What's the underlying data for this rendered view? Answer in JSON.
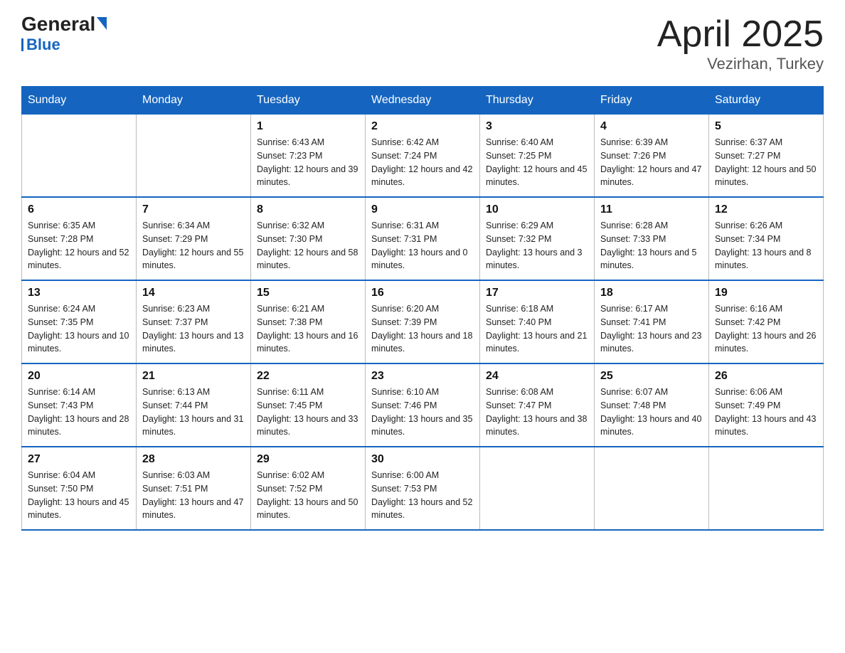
{
  "header": {
    "logo": {
      "general": "General",
      "blue": "Blue"
    },
    "title": "April 2025",
    "subtitle": "Vezirhan, Turkey"
  },
  "weekdays": [
    "Sunday",
    "Monday",
    "Tuesday",
    "Wednesday",
    "Thursday",
    "Friday",
    "Saturday"
  ],
  "weeks": [
    [
      {
        "day": "",
        "sunrise": "",
        "sunset": "",
        "daylight": ""
      },
      {
        "day": "",
        "sunrise": "",
        "sunset": "",
        "daylight": ""
      },
      {
        "day": "1",
        "sunrise": "Sunrise: 6:43 AM",
        "sunset": "Sunset: 7:23 PM",
        "daylight": "Daylight: 12 hours and 39 minutes."
      },
      {
        "day": "2",
        "sunrise": "Sunrise: 6:42 AM",
        "sunset": "Sunset: 7:24 PM",
        "daylight": "Daylight: 12 hours and 42 minutes."
      },
      {
        "day": "3",
        "sunrise": "Sunrise: 6:40 AM",
        "sunset": "Sunset: 7:25 PM",
        "daylight": "Daylight: 12 hours and 45 minutes."
      },
      {
        "day": "4",
        "sunrise": "Sunrise: 6:39 AM",
        "sunset": "Sunset: 7:26 PM",
        "daylight": "Daylight: 12 hours and 47 minutes."
      },
      {
        "day": "5",
        "sunrise": "Sunrise: 6:37 AM",
        "sunset": "Sunset: 7:27 PM",
        "daylight": "Daylight: 12 hours and 50 minutes."
      }
    ],
    [
      {
        "day": "6",
        "sunrise": "Sunrise: 6:35 AM",
        "sunset": "Sunset: 7:28 PM",
        "daylight": "Daylight: 12 hours and 52 minutes."
      },
      {
        "day": "7",
        "sunrise": "Sunrise: 6:34 AM",
        "sunset": "Sunset: 7:29 PM",
        "daylight": "Daylight: 12 hours and 55 minutes."
      },
      {
        "day": "8",
        "sunrise": "Sunrise: 6:32 AM",
        "sunset": "Sunset: 7:30 PM",
        "daylight": "Daylight: 12 hours and 58 minutes."
      },
      {
        "day": "9",
        "sunrise": "Sunrise: 6:31 AM",
        "sunset": "Sunset: 7:31 PM",
        "daylight": "Daylight: 13 hours and 0 minutes."
      },
      {
        "day": "10",
        "sunrise": "Sunrise: 6:29 AM",
        "sunset": "Sunset: 7:32 PM",
        "daylight": "Daylight: 13 hours and 3 minutes."
      },
      {
        "day": "11",
        "sunrise": "Sunrise: 6:28 AM",
        "sunset": "Sunset: 7:33 PM",
        "daylight": "Daylight: 13 hours and 5 minutes."
      },
      {
        "day": "12",
        "sunrise": "Sunrise: 6:26 AM",
        "sunset": "Sunset: 7:34 PM",
        "daylight": "Daylight: 13 hours and 8 minutes."
      }
    ],
    [
      {
        "day": "13",
        "sunrise": "Sunrise: 6:24 AM",
        "sunset": "Sunset: 7:35 PM",
        "daylight": "Daylight: 13 hours and 10 minutes."
      },
      {
        "day": "14",
        "sunrise": "Sunrise: 6:23 AM",
        "sunset": "Sunset: 7:37 PM",
        "daylight": "Daylight: 13 hours and 13 minutes."
      },
      {
        "day": "15",
        "sunrise": "Sunrise: 6:21 AM",
        "sunset": "Sunset: 7:38 PM",
        "daylight": "Daylight: 13 hours and 16 minutes."
      },
      {
        "day": "16",
        "sunrise": "Sunrise: 6:20 AM",
        "sunset": "Sunset: 7:39 PM",
        "daylight": "Daylight: 13 hours and 18 minutes."
      },
      {
        "day": "17",
        "sunrise": "Sunrise: 6:18 AM",
        "sunset": "Sunset: 7:40 PM",
        "daylight": "Daylight: 13 hours and 21 minutes."
      },
      {
        "day": "18",
        "sunrise": "Sunrise: 6:17 AM",
        "sunset": "Sunset: 7:41 PM",
        "daylight": "Daylight: 13 hours and 23 minutes."
      },
      {
        "day": "19",
        "sunrise": "Sunrise: 6:16 AM",
        "sunset": "Sunset: 7:42 PM",
        "daylight": "Daylight: 13 hours and 26 minutes."
      }
    ],
    [
      {
        "day": "20",
        "sunrise": "Sunrise: 6:14 AM",
        "sunset": "Sunset: 7:43 PM",
        "daylight": "Daylight: 13 hours and 28 minutes."
      },
      {
        "day": "21",
        "sunrise": "Sunrise: 6:13 AM",
        "sunset": "Sunset: 7:44 PM",
        "daylight": "Daylight: 13 hours and 31 minutes."
      },
      {
        "day": "22",
        "sunrise": "Sunrise: 6:11 AM",
        "sunset": "Sunset: 7:45 PM",
        "daylight": "Daylight: 13 hours and 33 minutes."
      },
      {
        "day": "23",
        "sunrise": "Sunrise: 6:10 AM",
        "sunset": "Sunset: 7:46 PM",
        "daylight": "Daylight: 13 hours and 35 minutes."
      },
      {
        "day": "24",
        "sunrise": "Sunrise: 6:08 AM",
        "sunset": "Sunset: 7:47 PM",
        "daylight": "Daylight: 13 hours and 38 minutes."
      },
      {
        "day": "25",
        "sunrise": "Sunrise: 6:07 AM",
        "sunset": "Sunset: 7:48 PM",
        "daylight": "Daylight: 13 hours and 40 minutes."
      },
      {
        "day": "26",
        "sunrise": "Sunrise: 6:06 AM",
        "sunset": "Sunset: 7:49 PM",
        "daylight": "Daylight: 13 hours and 43 minutes."
      }
    ],
    [
      {
        "day": "27",
        "sunrise": "Sunrise: 6:04 AM",
        "sunset": "Sunset: 7:50 PM",
        "daylight": "Daylight: 13 hours and 45 minutes."
      },
      {
        "day": "28",
        "sunrise": "Sunrise: 6:03 AM",
        "sunset": "Sunset: 7:51 PM",
        "daylight": "Daylight: 13 hours and 47 minutes."
      },
      {
        "day": "29",
        "sunrise": "Sunrise: 6:02 AM",
        "sunset": "Sunset: 7:52 PM",
        "daylight": "Daylight: 13 hours and 50 minutes."
      },
      {
        "day": "30",
        "sunrise": "Sunrise: 6:00 AM",
        "sunset": "Sunset: 7:53 PM",
        "daylight": "Daylight: 13 hours and 52 minutes."
      },
      {
        "day": "",
        "sunrise": "",
        "sunset": "",
        "daylight": ""
      },
      {
        "day": "",
        "sunrise": "",
        "sunset": "",
        "daylight": ""
      },
      {
        "day": "",
        "sunrise": "",
        "sunset": "",
        "daylight": ""
      }
    ]
  ],
  "colors": {
    "header_bg": "#1565c0",
    "logo_blue": "#1565c0"
  }
}
